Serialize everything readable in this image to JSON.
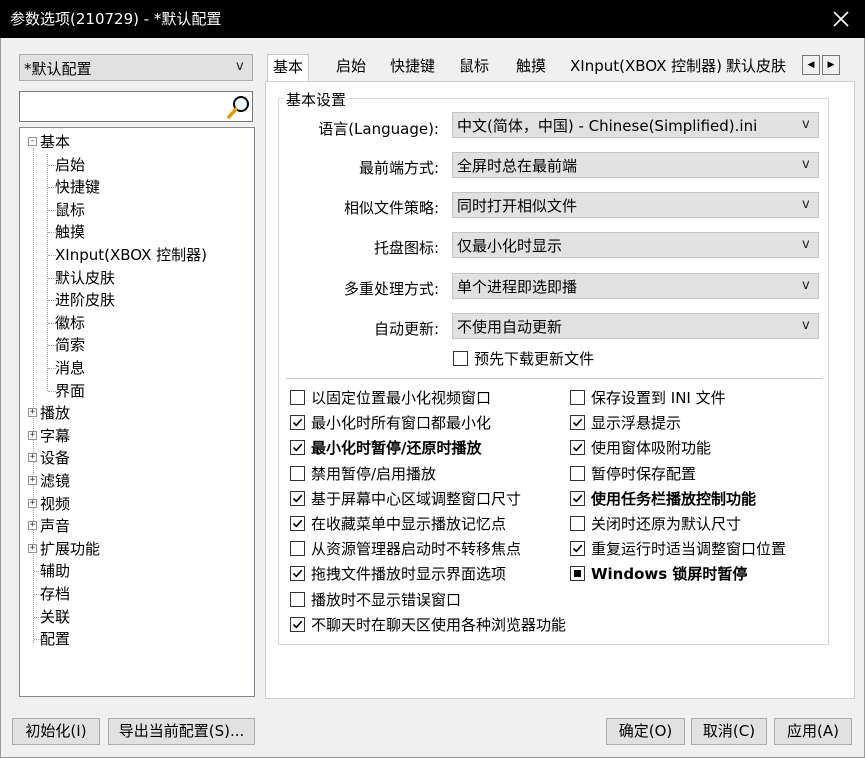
{
  "window": {
    "title": "参数选项(210729) - *默认配置"
  },
  "profile": {
    "selected": "*默认配置"
  },
  "search": {
    "placeholder": "",
    "value": ""
  },
  "tree": {
    "items": [
      "基本",
      "启始",
      "快捷键",
      "鼠标",
      "触摸",
      "XInput(XBOX 控制器)",
      "默认皮肤",
      "进阶皮肤",
      "徽标",
      "简索",
      "消息",
      "界面",
      "播放",
      "字幕",
      "设备",
      "滤镜",
      "视频",
      "声音",
      "扩展功能",
      "辅助",
      "存档",
      "关联",
      "配置"
    ]
  },
  "tabs": [
    "基本",
    "启始",
    "快捷键",
    "鼠标",
    "触摸",
    "XInput(XBOX 控制器)",
    "默认皮肤"
  ],
  "tab_scroll": {
    "left": "◀",
    "right": "▶"
  },
  "group": {
    "title": "基本设置"
  },
  "fields": [
    {
      "label": "语言(Language):",
      "value": "中文(简体，中国) - Chinese(Simplified).ini"
    },
    {
      "label": "最前端方式:",
      "value": "全屏时总在最前端"
    },
    {
      "label": "相似文件策略:",
      "value": "同时打开相似文件"
    },
    {
      "label": "托盘图标:",
      "value": "仅最小化时显示"
    },
    {
      "label": "多重处理方式:",
      "value": "单个进程即选即播"
    },
    {
      "label": "自动更新:",
      "value": "不使用自动更新"
    }
  ],
  "prefetch": {
    "label": "预先下载更新文件",
    "state": "unchecked"
  },
  "options_left": [
    {
      "label": "以固定位置最小化视频窗口",
      "state": "unchecked"
    },
    {
      "label": "最小化时所有窗口都最小化",
      "state": "checked"
    },
    {
      "label": "最小化时暂停/还原时播放",
      "state": "checked"
    },
    {
      "label": "禁用暂停/启用播放",
      "state": "unchecked"
    },
    {
      "label": "基于屏幕中心区域调整窗口尺寸",
      "state": "checked"
    },
    {
      "label": "在收藏菜单中显示播放记忆点",
      "state": "checked"
    },
    {
      "label": "从资源管理器启动时不转移焦点",
      "state": "unchecked"
    },
    {
      "label": "拖拽文件播放时显示界面选项",
      "state": "checked"
    },
    {
      "label": "播放时不显示错误窗口",
      "state": "unchecked"
    },
    {
      "label": "不聊天时在聊天区使用各种浏览器功能",
      "state": "checked"
    }
  ],
  "options_right": [
    {
      "label": "保存设置到 INI 文件",
      "state": "unchecked"
    },
    {
      "label": "显示浮悬提示",
      "state": "checked"
    },
    {
      "label": "使用窗体吸附功能",
      "state": "checked"
    },
    {
      "label": "暂停时保存配置",
      "state": "unchecked"
    },
    {
      "label": "使用任务栏播放控制功能",
      "state": "checked"
    },
    {
      "label": "关闭时还原为默认尺寸",
      "state": "unchecked"
    },
    {
      "label": "重复运行时适当调整窗口位置",
      "state": "checked"
    },
    {
      "label": "Windows 锁屏时暂停",
      "state": "indeterminate"
    }
  ],
  "buttons": {
    "init": "初始化(I)",
    "export": "导出当前配置(S)...",
    "ok": "确定(O)",
    "cancel": "取消(C)",
    "apply": "应用(A)"
  },
  "icons": {
    "close": "close-icon",
    "search": "search-icon",
    "dropdown": "chevron-down-icon"
  },
  "colors": {
    "titlebar": "#000000",
    "dialog_bg": "#f0f0f0",
    "button_bg": "#e1e1e1"
  }
}
